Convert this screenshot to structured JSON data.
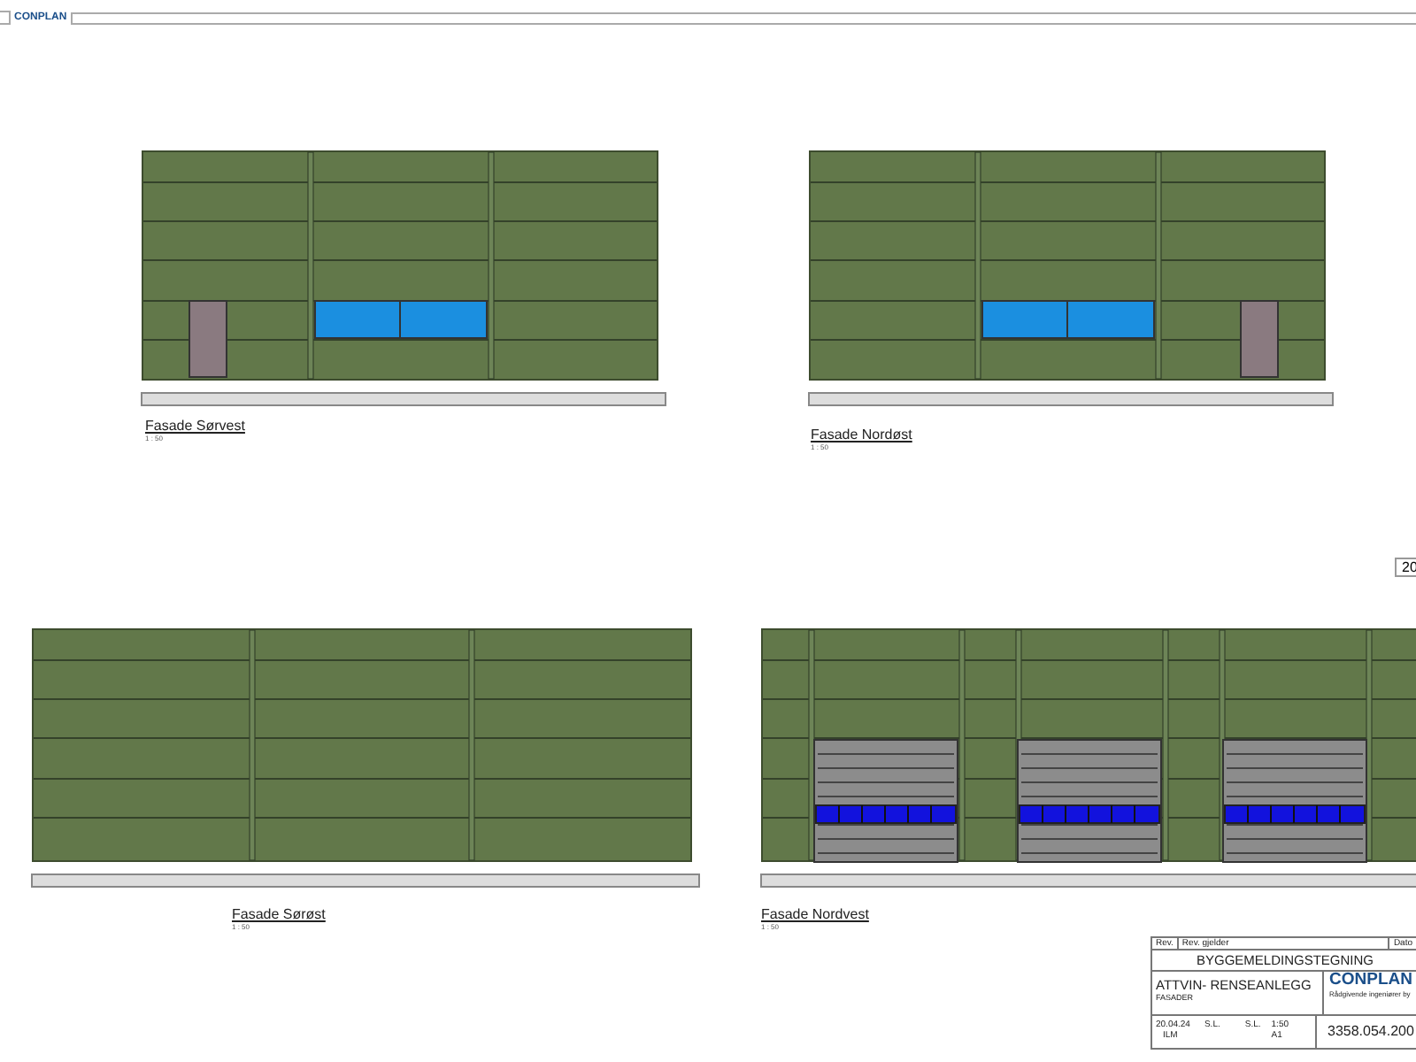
{
  "header": {
    "logo": "CONPLAN"
  },
  "facades": [
    {
      "kind": "door_left",
      "title": "Fasade Sørvest",
      "scale": "1 : 50"
    },
    {
      "kind": "door_right",
      "title": "Fasade Nordøst",
      "scale": "1 : 50"
    },
    {
      "kind": "plain",
      "title": "Fasade Sørøst",
      "scale": "1 : 50"
    },
    {
      "kind": "gates",
      "title": "Fasade Nordvest",
      "scale": "1 : 50"
    }
  ],
  "sheet_marker": "20",
  "title_block": {
    "rev_label": "Rev.",
    "rev_text_label": "Rev. gjelder",
    "date_label": "Dato",
    "stage": "BYGGEMELDINGSTEGNING",
    "project": "ATTVIN- RENSEANLEGG",
    "subtitle": "FASADER",
    "company": "CONPLAN",
    "tagline": "Rådgivende ingeniører by",
    "date": "20.04.24",
    "drawn_by": "S.L.",
    "checked_by": "S.L.",
    "scale": "1:50",
    "format": "A1",
    "made_by": "ILM",
    "drawing_number": "3358.054.200"
  }
}
